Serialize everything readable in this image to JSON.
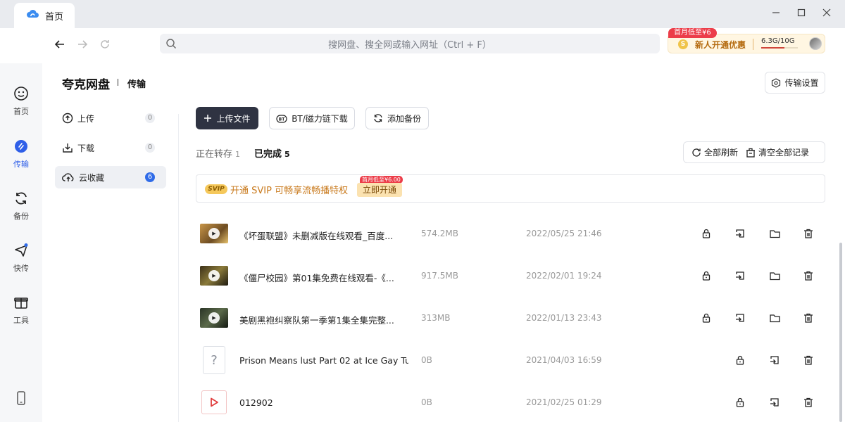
{
  "window": {
    "tab_title": "首页"
  },
  "search": {
    "placeholder": "搜网盘、搜全网或输入网址（Ctrl + F）"
  },
  "promo": {
    "badge": "首月低至¥6",
    "coin": "S",
    "text": "新人开通优惠",
    "storage": "6.3G/10G",
    "storage_fraction": 0.63
  },
  "sidebar": {
    "items": [
      {
        "label": "首页",
        "icon": "smile-face-icon"
      },
      {
        "label": "传输",
        "icon": "transfer-icon",
        "active": true
      },
      {
        "label": "备份",
        "icon": "backup-sync-icon"
      },
      {
        "label": "快传",
        "icon": "quick-send-icon"
      },
      {
        "label": "工具",
        "icon": "toolbox-icon"
      }
    ],
    "bottom_icon": "phone-icon"
  },
  "header": {
    "brand": "夸克网盘",
    "section": "传输",
    "settings": "传输设置"
  },
  "submenu": [
    {
      "label": "上传",
      "count": "0"
    },
    {
      "label": "下载",
      "count": "0"
    },
    {
      "label": "云收藏",
      "count": "6",
      "active": true
    }
  ],
  "actions": {
    "upload": "上传文件",
    "bt": "BT/磁力链下载",
    "backup": "添加备份"
  },
  "status_tabs": [
    {
      "label": "正在转存",
      "count": "1"
    },
    {
      "label": "已完成",
      "count": "5",
      "active": true
    }
  ],
  "records": {
    "refresh": "全部刷新",
    "clear": "清空全部记录"
  },
  "svip": {
    "logo": "SVIP",
    "text": "开通 SVIP 可畅享流畅播特权",
    "button": "立即开通",
    "badge": "首月低至¥6.00"
  },
  "files": [
    {
      "name": "《坏蛋联盟》未删减版在线观看_百度...",
      "size": "574.2MB",
      "date": "2022/05/25 21:46",
      "thumb": "video",
      "color": "#b07a3a"
    },
    {
      "name": "《僵尸校园》第01集免费在线观看-《...",
      "size": "917.5MB",
      "date": "2022/02/01 19:24",
      "thumb": "video",
      "color": "#5a4a2a"
    },
    {
      "name": "美剧黑袍纠察队第一季第1集全集完整...",
      "size": "313MB",
      "date": "2022/01/13 23:43",
      "thumb": "video",
      "color": "#2c3a2a"
    },
    {
      "name": "Prison Means lust Part 02 at Ice Gay Tu...",
      "size": "0B",
      "date": "2021/04/03 16:59",
      "thumb": "unknown"
    },
    {
      "name": "012902",
      "size": "0B",
      "date": "2021/02/25 01:29",
      "thumb": "video-red"
    }
  ]
}
